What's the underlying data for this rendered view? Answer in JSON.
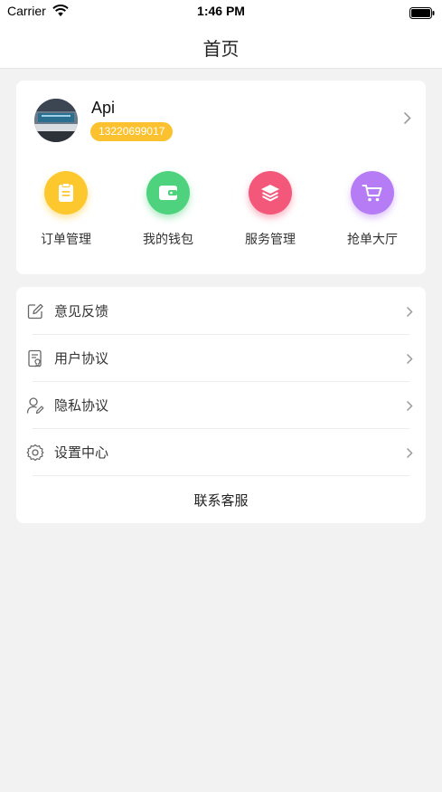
{
  "status_bar": {
    "carrier": "Carrier",
    "time": "1:46 PM"
  },
  "nav": {
    "title": "首页"
  },
  "profile": {
    "name": "Api",
    "phone": "13220699017"
  },
  "shortcuts": [
    {
      "label": "订单管理",
      "icon": "order-clipboard-icon",
      "color": "#fdc72e"
    },
    {
      "label": "我的钱包",
      "icon": "wallet-icon",
      "color": "#4ed27d"
    },
    {
      "label": "服务管理",
      "icon": "layers-icon",
      "color": "#f3577a"
    },
    {
      "label": "抢单大厅",
      "icon": "cart-icon",
      "color": "#b67cf5"
    }
  ],
  "menu": [
    {
      "label": "意见反馈",
      "icon": "feedback-edit-icon"
    },
    {
      "label": "用户协议",
      "icon": "agreement-document-icon"
    },
    {
      "label": "隐私协议",
      "icon": "privacy-user-pen-icon"
    },
    {
      "label": "设置中心",
      "icon": "settings-gear-icon"
    }
  ],
  "contact": {
    "label": "联系客服"
  },
  "colors": {
    "background": "#f2f2f2",
    "badge": "#fbc12f"
  }
}
